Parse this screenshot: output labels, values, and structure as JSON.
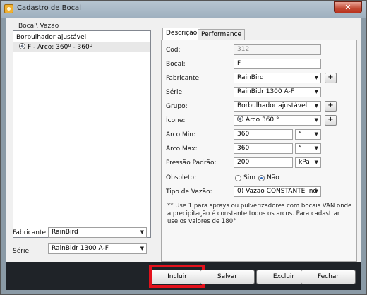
{
  "window": {
    "title": "Cadastro de Bocal",
    "close": "✕"
  },
  "left": {
    "header": "Bocal\\ Vazão",
    "tree_root": "Borbulhador ajustável",
    "tree_child": "F - Arco: 360º - 360º",
    "fabricante_label": "Fabricante:",
    "fabricante_value": "RainBird",
    "serie_label": "Série:",
    "serie_value": "RainBidr 1300 A-F"
  },
  "tabs": [
    "Descrição",
    "Performance"
  ],
  "form": {
    "cod_label": "Cod:",
    "cod_value": "312",
    "bocal_label": "Bocal:",
    "bocal_value": "F",
    "fabricante_label": "Fabricante:",
    "fabricante_value": "RainBird",
    "serie_label": "Série:",
    "serie_value": "RainBidr 1300 A-F",
    "grupo_label": "Grupo:",
    "grupo_value": "Borbulhador ajustável",
    "icone_label": "Ícone:",
    "icone_value": "Arco 360 °",
    "arco_min_label": "Arco Min:",
    "arco_min_value": "360",
    "arco_min_unit": "°",
    "arco_max_label": "Arco Max:",
    "arco_max_value": "360",
    "arco_max_unit": "°",
    "pressao_label": "Pressão Padrão:",
    "pressao_value": "200",
    "pressao_unit": "kPa",
    "obsoleto_label": "Obsoleto:",
    "obsoleto_sim": "Sim",
    "obsoleto_nao": "Não",
    "tipo_vazao_label": "Tipo de Vazão:",
    "tipo_vazao_value": "0) Vazão CONSTANTE ind",
    "plus": "+",
    "note": "** Use 1 para sprays ou pulverizadores com bocais VAN onde a precipitação é constante todos os arcos. Para cadastrar use os valores de 180°"
  },
  "buttons": {
    "incluir": "Incluir",
    "salvar": "Salvar",
    "excluir": "Excluir",
    "fechar": "Fechar"
  },
  "colors": {
    "highlight": "#e4111c"
  }
}
